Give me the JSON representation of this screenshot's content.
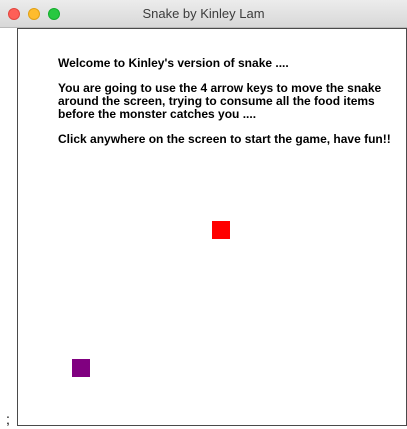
{
  "window": {
    "title": "Snake by Kinley Lam"
  },
  "intro": {
    "line1": "Welcome to Kinley's version of snake ....",
    "line2": "You are going to use the 4 arrow keys to move the snake around the screen, trying to consume all the food items before the monster catches you ....",
    "line3": "Click anywhere on the screen to start the game, have fun!!"
  },
  "colors": {
    "food": "#ff0000",
    "monster": "#800080"
  },
  "stray_char": ";"
}
